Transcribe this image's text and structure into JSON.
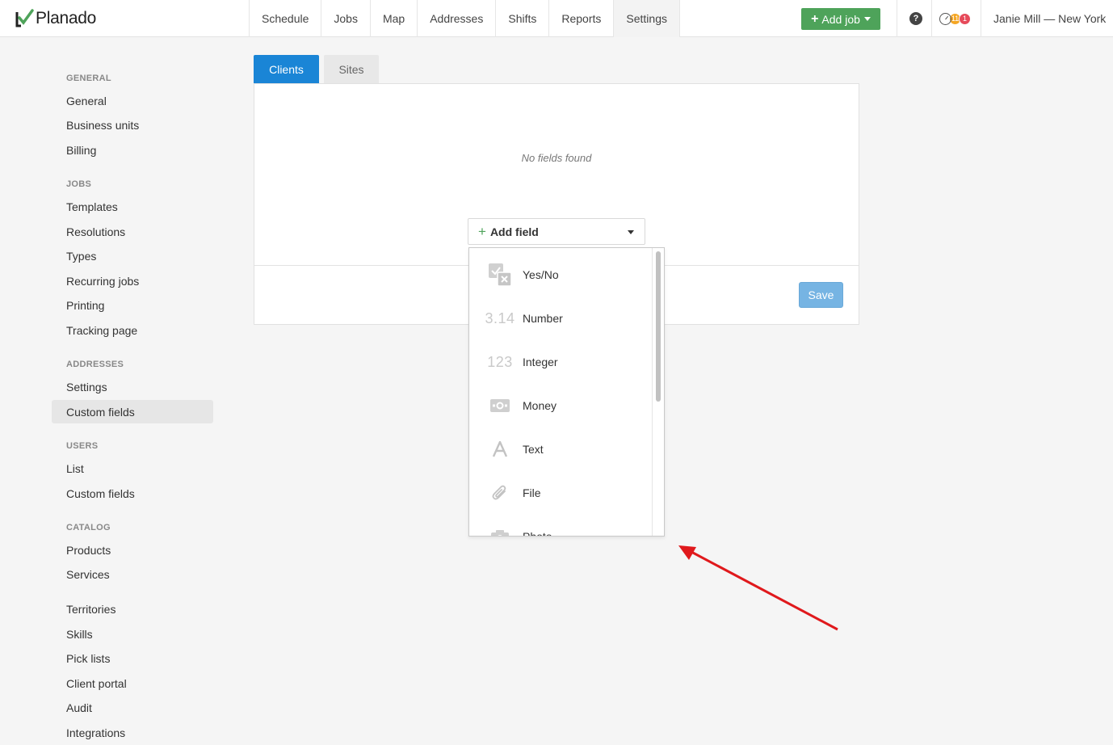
{
  "app": {
    "name": "Planado",
    "brand_color": "#4ea35a"
  },
  "nav": {
    "items": [
      {
        "label": "Schedule"
      },
      {
        "label": "Jobs"
      },
      {
        "label": "Map"
      },
      {
        "label": "Addresses"
      },
      {
        "label": "Shifts"
      },
      {
        "label": "Reports"
      },
      {
        "label": "Settings",
        "active": true
      }
    ]
  },
  "header": {
    "add_job_label": "Add job",
    "help_label": "?",
    "badge_orange": "11",
    "badge_red": "1",
    "user_label": "Janie Mill — New York"
  },
  "sidebar": {
    "sections": [
      {
        "heading": "GENERAL",
        "items": [
          "General",
          "Business units",
          "Billing"
        ]
      },
      {
        "heading": "JOBS",
        "items": [
          "Templates",
          "Resolutions",
          "Types",
          "Recurring jobs",
          "Printing",
          "Tracking page"
        ]
      },
      {
        "heading": "ADDRESSES",
        "items": [
          "Settings",
          "Custom fields"
        ]
      },
      {
        "heading": "USERS",
        "items": [
          "List",
          "Custom fields"
        ]
      },
      {
        "heading": "CATALOG",
        "items": [
          "Products",
          "Services"
        ]
      },
      {
        "heading": "",
        "items": [
          "Territories",
          "Skills",
          "Pick lists",
          "Client portal",
          "Audit",
          "Integrations"
        ]
      }
    ],
    "active_item": "Custom fields"
  },
  "tabs": [
    {
      "label": "Clients",
      "active": true
    },
    {
      "label": "Sites",
      "active": false
    }
  ],
  "panel": {
    "empty_text": "No fields found",
    "save_label": "Save"
  },
  "add_field": {
    "label": "Add field",
    "options": [
      {
        "label": "Yes/No",
        "icon": "checkbox-cross-icon"
      },
      {
        "label": "Number",
        "icon": "3.14"
      },
      {
        "label": "Integer",
        "icon": "123"
      },
      {
        "label": "Money",
        "icon": "banknote-icon"
      },
      {
        "label": "Text",
        "icon": "letter-a-icon"
      },
      {
        "label": "File",
        "icon": "paperclip-icon"
      },
      {
        "label": "Photo",
        "icon": "camera-icon"
      }
    ]
  },
  "colors": {
    "active_tab": "#1a85d6",
    "save_button": "#76b4e3",
    "annotation_arrow": "#e0191c"
  }
}
